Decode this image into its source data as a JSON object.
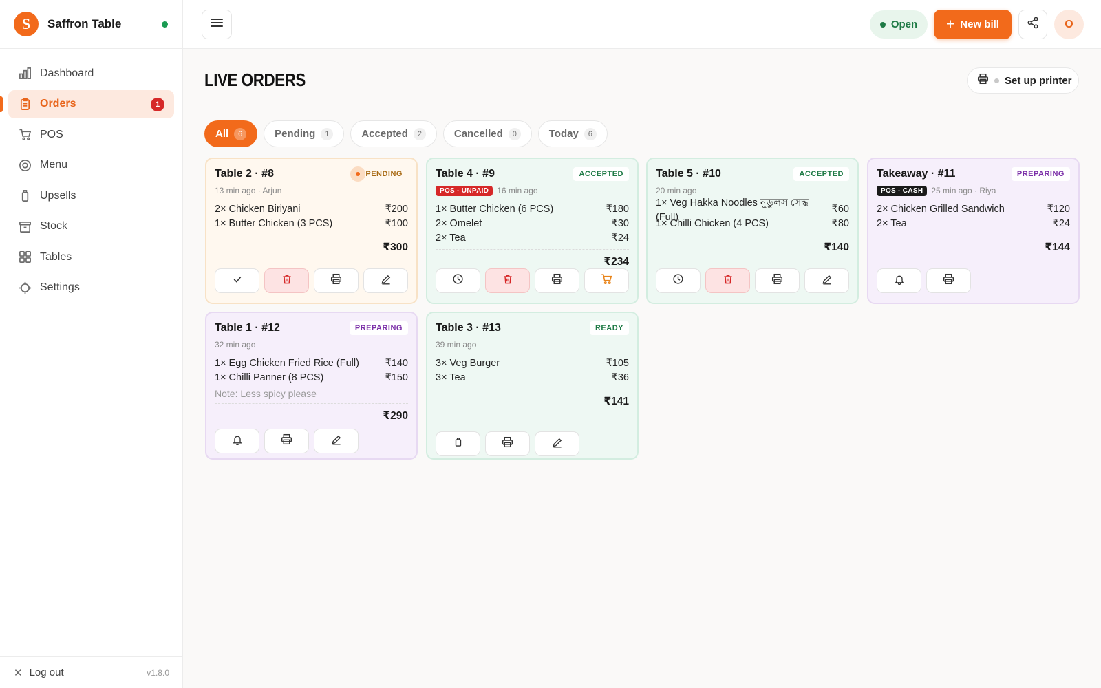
{
  "brand": {
    "name": "Saffron Table",
    "logo_letter": "S",
    "status_color": "#1a9b52"
  },
  "sidebar": {
    "items": [
      {
        "label": "Dashboard",
        "icon": "bar-chart-icon"
      },
      {
        "label": "Orders",
        "icon": "clipboard-icon",
        "badge": "1",
        "active": true
      },
      {
        "label": "POS",
        "icon": "cart-icon"
      },
      {
        "label": "Menu",
        "icon": "target-icon"
      },
      {
        "label": "Upsells",
        "icon": "bottle-icon"
      },
      {
        "label": "Stock",
        "icon": "archive-icon"
      },
      {
        "label": "Tables",
        "icon": "grid-icon"
      },
      {
        "label": "Settings",
        "icon": "gear-icon"
      }
    ],
    "logout": "Log out",
    "version": "v1.8.0"
  },
  "topbar": {
    "open_label": "Open",
    "new_bill_label": "New bill",
    "avatar_letter": "O",
    "accent": "#f26a1b"
  },
  "main": {
    "title": "LIVE ORDERS",
    "printer_label": "Set up printer",
    "tabs": [
      {
        "label": "All",
        "count": "6",
        "active": true
      },
      {
        "label": "Pending",
        "count": "1"
      },
      {
        "label": "Accepted",
        "count": "2"
      },
      {
        "label": "Cancelled",
        "count": "0"
      },
      {
        "label": "Today",
        "count": "6"
      }
    ]
  },
  "orders": [
    {
      "title": "Table 2 · #8",
      "status": "PENDING",
      "meta": "13 min ago · Arjun",
      "items": [
        {
          "name": "2× Chicken Biriyani",
          "price": "₹200"
        },
        {
          "name": "1× Butter Chicken (3 PCS)",
          "price": "₹100"
        }
      ],
      "total": "₹300",
      "actions": [
        "check-icon",
        "trash-icon",
        "printer-icon",
        "pencil-icon"
      ]
    },
    {
      "title": "Table 4 · #9",
      "status": "ACCEPTED",
      "tag": "POS · UNPAID",
      "meta": "16 min ago",
      "items": [
        {
          "name": "1× Butter Chicken (6 PCS)",
          "price": "₹180"
        },
        {
          "name": "2× Omelet",
          "price": "₹30"
        },
        {
          "name": "2× Tea",
          "price": "₹24"
        }
      ],
      "total": "₹234",
      "actions": [
        "clock-icon",
        "trash-icon",
        "printer-icon",
        "cart-icon"
      ]
    },
    {
      "title": "Table 5 · #10",
      "status": "ACCEPTED",
      "meta": "20 min ago",
      "items": [
        {
          "name": "1× Veg Hakka Noodles নুডুলস সেদ্ধ (Full)",
          "price": "₹60"
        },
        {
          "name": "1× Chilli Chicken (4 PCS)",
          "price": "₹80"
        }
      ],
      "total": "₹140",
      "actions": [
        "clock-icon",
        "trash-icon",
        "printer-icon",
        "pencil-icon"
      ]
    },
    {
      "title": "Takeaway · #11",
      "status": "PREPARING",
      "tag": "POS · CASH",
      "meta": "25 min ago · Riya",
      "items": [
        {
          "name": "2× Chicken Grilled Sandwich",
          "price": "₹120"
        },
        {
          "name": "2× Tea",
          "price": "₹24"
        }
      ],
      "total": "₹144",
      "actions": [
        "bell-icon",
        "printer-icon"
      ]
    },
    {
      "title": "Table 1 · #12",
      "status": "PREPARING",
      "meta": "32 min ago",
      "items": [
        {
          "name": "1× Egg Chicken Fried Rice (Full)",
          "price": "₹140"
        },
        {
          "name": "1× Chilli Panner (8 PCS)",
          "price": "₹150"
        }
      ],
      "note": "Note: Less spicy please",
      "total": "₹290",
      "actions": [
        "bell-icon",
        "printer-icon",
        "pencil-icon"
      ]
    },
    {
      "title": "Table 3 · #13",
      "status": "READY",
      "meta": "39 min ago",
      "items": [
        {
          "name": "3× Veg Burger",
          "price": "₹105"
        },
        {
          "name": "3× Tea",
          "price": "₹36"
        }
      ],
      "total": "₹141",
      "actions": [
        "bin-icon",
        "printer-icon",
        "pencil-icon"
      ]
    }
  ]
}
